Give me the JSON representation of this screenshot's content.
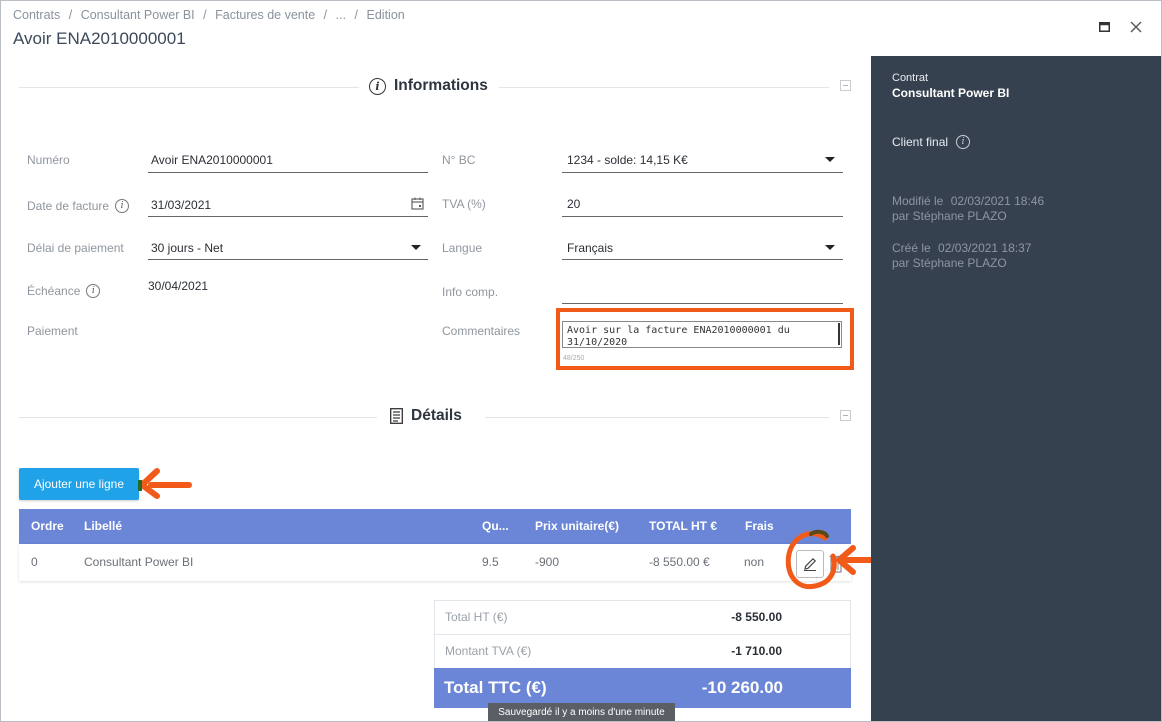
{
  "header": {
    "breadcrumb": [
      "Contrats",
      "Consultant Power BI",
      "Factures de vente",
      "...",
      "Edition"
    ],
    "separator": "/",
    "title": "Avoir ENA2010000001"
  },
  "sections": {
    "informations": "Informations",
    "details": "Détails"
  },
  "form": {
    "numero_label": "Numéro",
    "numero_value": "Avoir ENA2010000001",
    "date_label": "Date de facture",
    "date_value": "31/03/2021",
    "delai_label": "Délai de paiement",
    "delai_value": "30 jours - Net",
    "echeance_label": "Échéance",
    "echeance_value": "30/04/2021",
    "paiement_label": "Paiement",
    "bc_label": "N° BC",
    "bc_value": "1234 - solde: 14,15 K€",
    "tva_label": "TVA (%)",
    "tva_value": "20",
    "langue_label": "Langue",
    "langue_value": "Français",
    "info_label": "Info comp.",
    "info_value": "",
    "commentaires_label": "Commentaires",
    "commentaires_value": "Avoir sur la facture ENA2010000001 du 31/10/2020",
    "commentaires_counter": "48/250"
  },
  "details": {
    "add_button": "Ajouter une ligne",
    "columns": [
      "Ordre",
      "Libellé",
      "Qu...",
      "Prix unitaire(€)",
      "TOTAL HT €",
      "Frais"
    ],
    "rows": [
      {
        "ordre": "0",
        "libelle": "Consultant Power BI",
        "qte": "9.5",
        "prix": "-900",
        "total": "-8 550.00 €",
        "frais": "non"
      }
    ]
  },
  "totals": {
    "ht_label": "Total HT (€)",
    "ht_value": "-8 550.00",
    "tva_label": "Montant TVA (€)",
    "tva_value": "-1 710.00",
    "ttc_label": "Total TTC (€)",
    "ttc_value": "-10 260.00"
  },
  "toast": "Sauvegardé il y a moins d'une minute",
  "side": {
    "contrat_label": "Contrat",
    "contrat_value": "Consultant Power BI",
    "client_label": "Client final",
    "modifie_label": "Modifié le",
    "modifie_date": "02/03/2021 18:46",
    "modifie_by": "par Stéphane PLAZO",
    "cree_label": "Créé le",
    "cree_date": "02/03/2021 18:37",
    "cree_by": "par Stéphane PLAZO"
  },
  "colors": {
    "accent_blue": "#1fa2e8",
    "table_header": "#6b86d6",
    "side_panel": "#36414f",
    "annotation": "#f25a1a"
  },
  "icons": [
    "info-icon",
    "calendar-icon",
    "document-icon",
    "edit-icon",
    "trash-icon",
    "maximize-icon",
    "close-icon",
    "chevron-down-icon"
  ]
}
